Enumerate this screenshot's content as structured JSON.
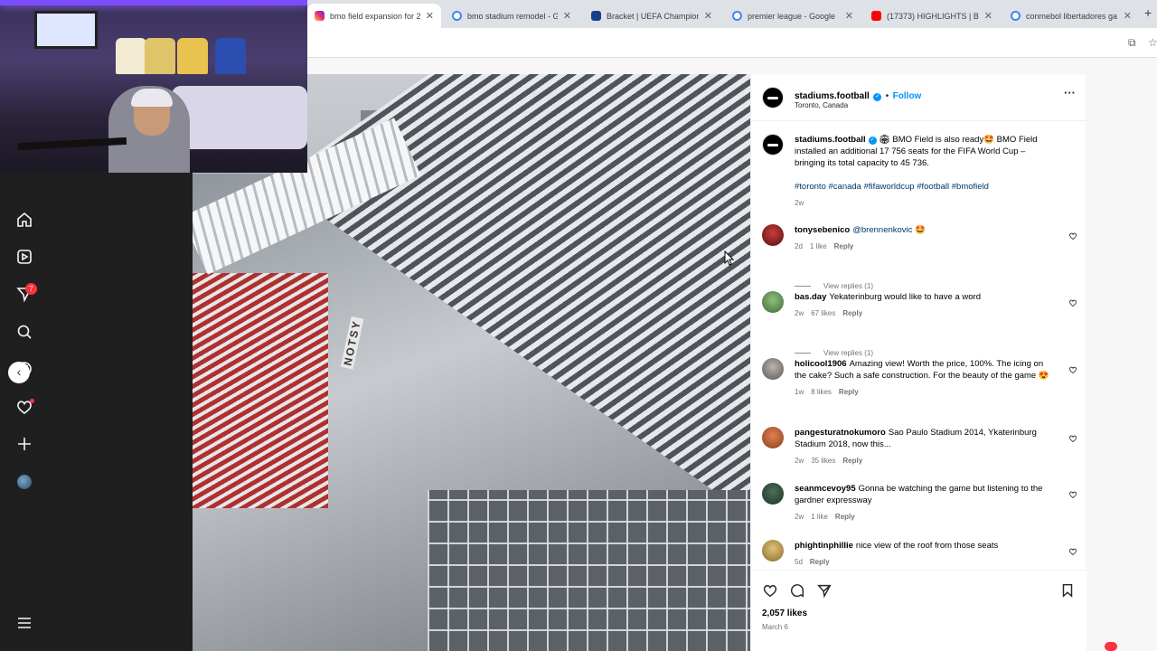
{
  "tabs": [
    {
      "title": "bmo field expansion for 2",
      "color": "#d6249f"
    },
    {
      "title": "bmo stadium remodel - G",
      "color": "#4285f4"
    },
    {
      "title": "Bracket | UEFA Champion",
      "color": "#1a3e8c"
    },
    {
      "title": "premier league - Google",
      "color": "#4285f4"
    },
    {
      "title": "(17373) HIGHLIGHTS | Ba",
      "color": "#ff0000"
    },
    {
      "title": "conmebol libertadores ga",
      "color": "#4285f4"
    }
  ],
  "rail": {
    "icons": [
      "home-icon",
      "reels-icon",
      "messages-icon",
      "search-icon",
      "explore-icon",
      "notifications-icon",
      "create-icon",
      "profile-icon",
      "menu-icon"
    ],
    "messages_badge": "7"
  },
  "media": {
    "banner_text": "NOTSY"
  },
  "post": {
    "username": "stadiums.football",
    "follow_label": "Follow",
    "location": "Toronto, Canada",
    "caption_user": "stadiums.football",
    "caption": "🏟 BMO Field is also ready🤩 BMO Field installed an additional 17 756 seats for the FIFA World Cup – bringing its total capacity to 45 736.",
    "hashtags": "#toronto #canada #fifaworldcup #football #bmofield",
    "caption_age": "2w",
    "likes": "2,057 likes",
    "date": "March 6"
  },
  "comments": [
    {
      "user": "tonysebenico",
      "mention": "@brennenkovic",
      "text": " 🤩",
      "age": "2d",
      "likes": "1 like",
      "reply": "Reply",
      "replies": "View replies (1)"
    },
    {
      "user": "bas.day",
      "mention": "",
      "text": "Yekaterinburg would like to have a word",
      "age": "2w",
      "likes": "67 likes",
      "reply": "Reply",
      "replies": "View replies (1)"
    },
    {
      "user": "holicool1906",
      "mention": "",
      "text": "Amazing view! Worth the price, 100%. The icing on the cake? Such a safe construction. For the beauty of the game 😍",
      "age": "1w",
      "likes": "8 likes",
      "reply": "Reply",
      "replies": ""
    },
    {
      "user": "pangesturatnokumoro",
      "mention": "",
      "text": "Sao Paulo Stadium 2014, Ykaterinburg Stadium 2018, now this...",
      "age": "2w",
      "likes": "35 likes",
      "reply": "Reply",
      "replies": ""
    },
    {
      "user": "seanmcevoy95",
      "mention": "",
      "text": "Gonna be watching the game but listening to the gardner expressway",
      "age": "2w",
      "likes": "1 like",
      "reply": "Reply",
      "replies": ""
    },
    {
      "user": "phightinphillie",
      "mention": "",
      "text": "nice view of the roof from those seats",
      "age": "5d",
      "likes": "",
      "reply": "Reply",
      "replies": ""
    }
  ],
  "colors": {
    "link": "#0095f6",
    "hashtag": "#00376b",
    "badge": "#ff3040"
  }
}
